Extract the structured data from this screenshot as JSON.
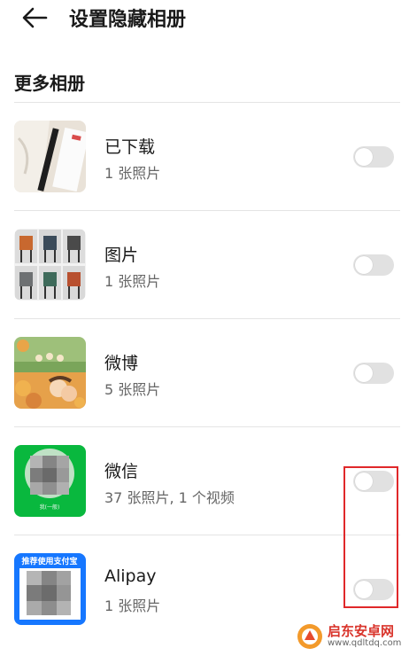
{
  "header": {
    "title": "设置隐藏相册",
    "back_icon": "arrow-left-icon"
  },
  "section_title": "更多相册",
  "albums": [
    {
      "name": "已下载",
      "count": "1 张照片",
      "hidden": false
    },
    {
      "name": "图片",
      "count": "1 张照片",
      "hidden": false
    },
    {
      "name": "微博",
      "count": "5 张照片",
      "hidden": false
    },
    {
      "name": "微信",
      "count": "37 张照片, 1 个视频",
      "hidden": false,
      "thumb_caption": "我(一般)"
    },
    {
      "name": "Alipay",
      "count": "1 张照片",
      "hidden": false,
      "thumb_banner": "推荐使用支付宝"
    }
  ],
  "watermark": {
    "text": "启东安卓网",
    "url": "www.qdltdq.com"
  },
  "colors": {
    "highlight": "#e0282a",
    "toggle_off": "#e1e1e1",
    "wechat_green": "#09b83e",
    "alipay_blue": "#1677ff"
  }
}
